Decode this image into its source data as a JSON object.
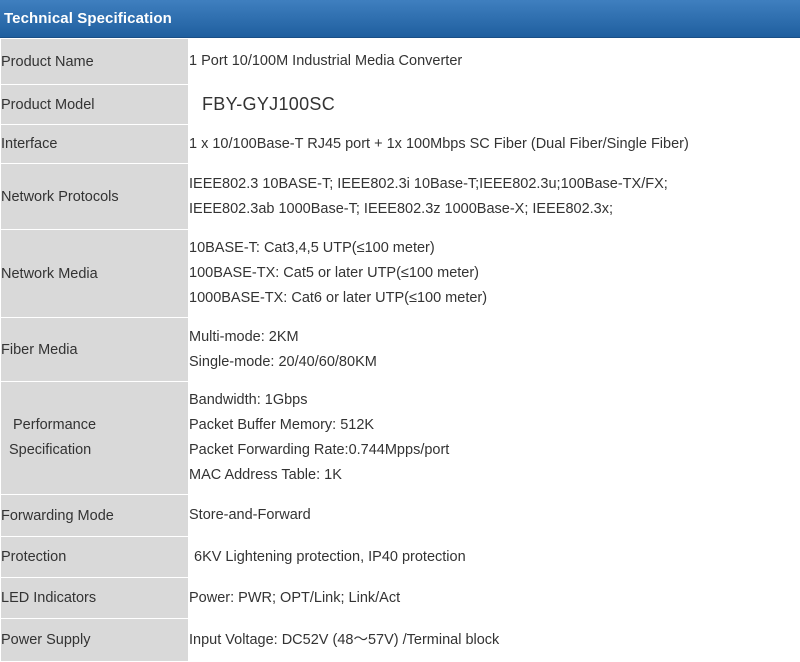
{
  "header": {
    "title": "Technical Specification"
  },
  "rows": [
    {
      "label": "Product Name",
      "values": [
        "1 Port 10/100M Industrial Media Converter"
      ]
    },
    {
      "label": "Product Model",
      "values": [
        "FBY-GYJ100SC"
      ]
    },
    {
      "label": "Interface",
      "values": [
        "1 x 10/100Base-T RJ45 port + 1x 100Mbps SC Fiber (Dual Fiber/Single Fiber)"
      ]
    },
    {
      "label": "Network Protocols",
      "values": [
        "IEEE802.3 10BASE-T; IEEE802.3i 10Base-T;IEEE802.3u;100Base-TX/FX;",
        "IEEE802.3ab 1000Base-T; IEEE802.3z 1000Base-X; IEEE802.3x;"
      ]
    },
    {
      "label": "Network Media",
      "values": [
        "10BASE-T: Cat3,4,5 UTP(≤100 meter)",
        "100BASE-TX: Cat5 or later UTP(≤100 meter)",
        "1000BASE-TX: Cat6 or later UTP(≤100 meter)"
      ]
    },
    {
      "label": "Fiber Media",
      "values": [
        "Multi-mode: 2KM",
        "Single-mode: 20/40/60/80KM"
      ]
    },
    {
      "label_lines": [
        "Performance",
        "Specification"
      ],
      "values": [
        "Bandwidth: 1Gbps",
        "Packet Buffer Memory: 512K",
        "Packet Forwarding Rate:0.744Mpps/port",
        "MAC Address Table: 1K"
      ]
    },
    {
      "label": "Forwarding Mode",
      "values": [
        "Store-and-Forward"
      ]
    },
    {
      "label": "Protection",
      "values": [
        "6KV Lightening protection, IP40 protection"
      ]
    },
    {
      "label": "LED Indicators",
      "values": [
        "Power: PWR; OPT/Link; Link/Act"
      ]
    },
    {
      "label": "Power Supply",
      "values": [
        "Input Voltage: DC52V (48～57V) /Terminal block"
      ]
    }
  ]
}
